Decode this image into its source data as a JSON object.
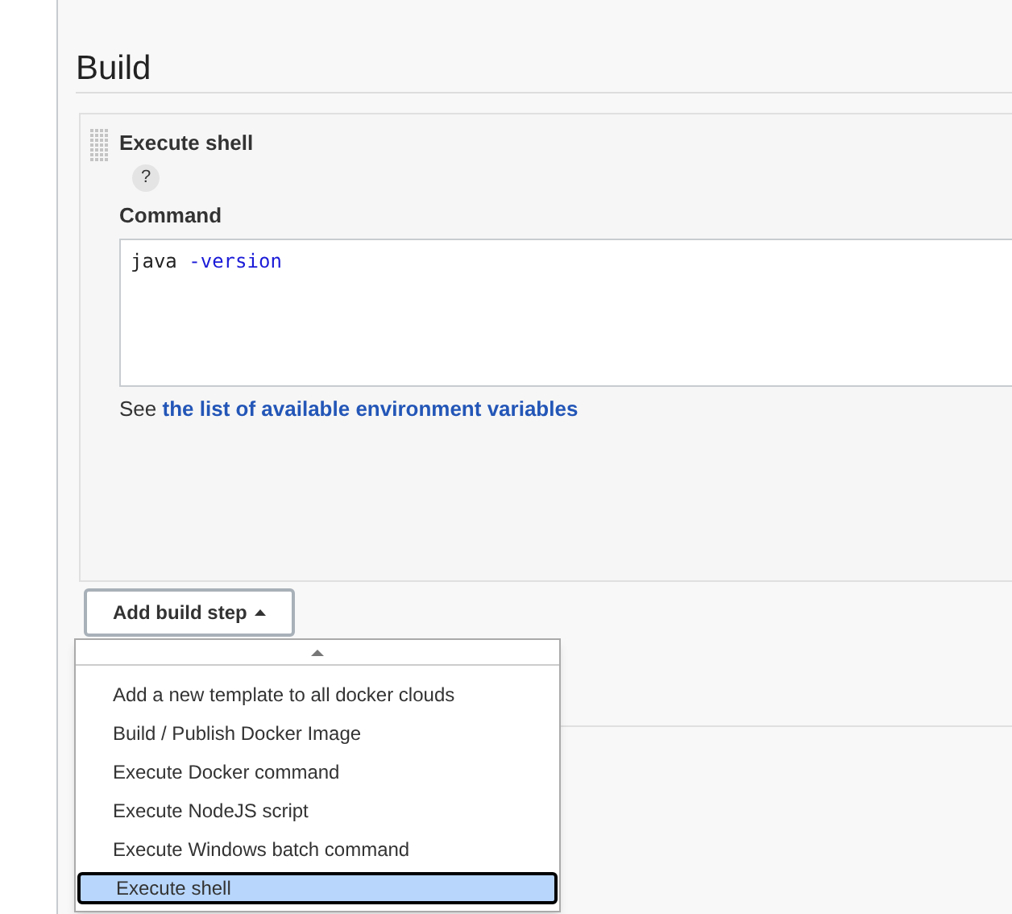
{
  "section": {
    "title": "Build"
  },
  "step": {
    "title": "Execute shell",
    "help": "?",
    "command_label": "Command",
    "command_tokens": [
      {
        "text": "java",
        "kind": "plain"
      },
      {
        "text": "-version",
        "kind": "option"
      }
    ],
    "hint_prefix": "See",
    "hint_link": "the list of available environment variables"
  },
  "add_button": {
    "label": "Add build step",
    "expanded": true
  },
  "menu": {
    "items": [
      {
        "label": "Add a new template to all docker clouds",
        "selected": false
      },
      {
        "label": "Build / Publish Docker Image",
        "selected": false
      },
      {
        "label": "Execute Docker command",
        "selected": false
      },
      {
        "label": "Execute NodeJS script",
        "selected": false
      },
      {
        "label": "Execute Windows batch command",
        "selected": false
      },
      {
        "label": "Execute shell",
        "selected": true
      }
    ]
  }
}
